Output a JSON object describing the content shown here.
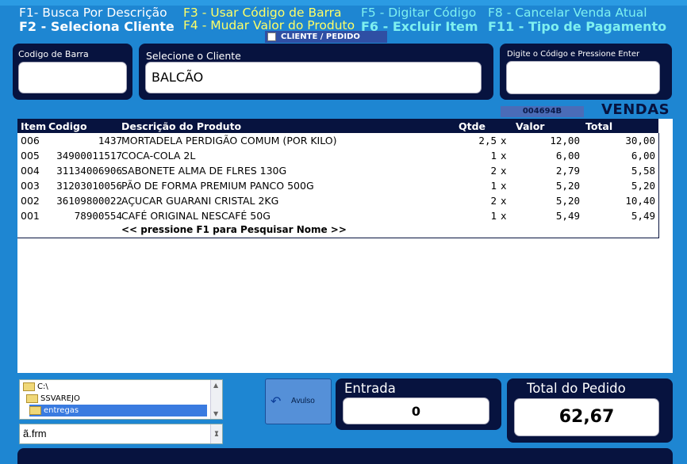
{
  "hotkeys": {
    "f1": "F1- Busca Por Descrição",
    "f2": "F2 - Seleciona Cliente",
    "f3": "F3 -  Usar Código de Barra",
    "f4": "F4 -  Mudar Valor do Produto",
    "f5": "F5 -  Digitar Código",
    "f6": "F6 -   Excluir Item",
    "f8": "F8 - Cancelar Venda Atual",
    "f11": "F11 -  Tipo de Pagamento"
  },
  "cliente_pedido_label": "CLIENTE / PEDIDO",
  "barcode": {
    "label": "Codigo de Barra",
    "value": ""
  },
  "client": {
    "label": "Selecione o Cliente",
    "value": "BALCÃO"
  },
  "code_entry": {
    "label": "Digite o Código    e   Pressione Enter",
    "value": ""
  },
  "order_number": "004694B",
  "mode_label": "VENDAS",
  "grid": {
    "headers": {
      "item": "Item",
      "codigo": "Codigo",
      "descricao": "Descrição do Produto",
      "qtde": "Qtde",
      "valor": "Valor",
      "total": "Total"
    },
    "rows": [
      {
        "item": "006",
        "codigo": "1437",
        "descricao": "MORTADELA PERDIGÃO COMUM (POR KILO)",
        "qtde": "2,5",
        "x": "x",
        "valor": "12,00",
        "total": "30,00"
      },
      {
        "item": "005",
        "codigo": "34900011517",
        "descricao": "COCA-COLA 2L",
        "qtde": "1",
        "x": "x",
        "valor": "6,00",
        "total": "6,00"
      },
      {
        "item": "004",
        "codigo": "31134006906",
        "descricao": "SABONETE ALMA DE FLRES 130G",
        "qtde": "2",
        "x": "x",
        "valor": "2,79",
        "total": "5,58"
      },
      {
        "item": "003",
        "codigo": "31203010056",
        "descricao": "PÃO DE FORMA PREMIUM PANCO 500G",
        "qtde": "1",
        "x": "x",
        "valor": "5,20",
        "total": "5,20"
      },
      {
        "item": "002",
        "codigo": "36109800022",
        "descricao": "AÇUCAR GUARANI CRISTAL 2KG",
        "qtde": "2",
        "x": "x",
        "valor": "5,20",
        "total": "10,40"
      },
      {
        "item": "001",
        "codigo": "78900554",
        "descricao": "CAFÉ ORIGINAL NESCAFÉ 50G",
        "qtde": "1",
        "x": "x",
        "valor": "5,49",
        "total": "5,49"
      }
    ],
    "hint": "<< pressione F1 para Pesquisar Nome >>"
  },
  "folders": [
    {
      "name": "C:\\",
      "selected": false
    },
    {
      "name": "SSVAREJO",
      "selected": false
    },
    {
      "name": "entregas",
      "selected": true
    }
  ],
  "file_field": "ã.frm",
  "avulso_button": "Avulso",
  "entrada": {
    "label": "Entrada",
    "value": "0"
  },
  "total_pedido": {
    "label": "Total do Pedido",
    "value": "62,67"
  },
  "icons": {
    "avulso": "undo-arrow-icon",
    "folder": "folder-icon"
  },
  "colors": {
    "background": "#1e86d2",
    "panel": "#07133f",
    "yellow": "#ffff66",
    "cyan": "#7ef0f0"
  }
}
